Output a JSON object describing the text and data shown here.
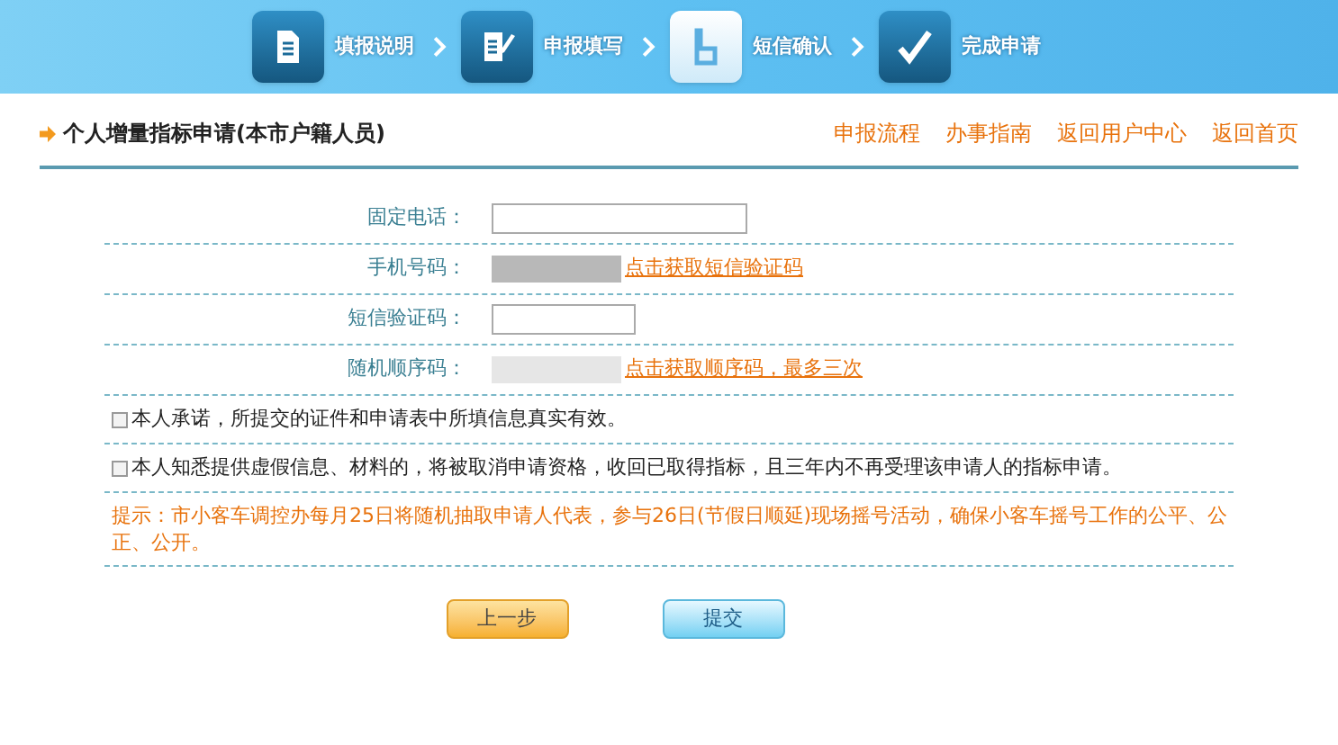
{
  "steps": [
    {
      "label": "填报说明",
      "selected": false
    },
    {
      "label": "申报填写",
      "selected": false
    },
    {
      "label": "短信确认",
      "selected": true
    },
    {
      "label": "完成申请",
      "selected": false
    }
  ],
  "page_title": "个人增量指标申请(本市户籍人员)",
  "nav_links": [
    "申报流程",
    "办事指南",
    "返回用户中心",
    "返回首页"
  ],
  "fields": [
    {
      "kind": "wide_input",
      "label": "固定电话："
    },
    {
      "kind": "mobile",
      "label": "手机号码：",
      "link": "点击获取短信验证码"
    },
    {
      "kind": "short_input",
      "label": "短信验证码："
    },
    {
      "kind": "sequence",
      "label": "随机顺序码：",
      "link": "点击获取顺序码，最多三次"
    }
  ],
  "pledges": [
    {
      "text": "本人承诺，所提交的证件和申请表中所填信息真实有效。",
      "checked": false
    },
    {
      "text": "本人知悉提供虚假信息、材料的，将被取消申请资格，收回已取得指标，且三年内不再受理该申请人的指标申请。",
      "checked": false
    }
  ],
  "notice": "提示：市小客车调控办每月25日将随机抽取申请人代表，参与26日(节假日顺延)现场摇号活动，确保小客车摇号工作的公平、公正、公开。",
  "buttons": [
    {
      "label": "上一步",
      "kind": "back"
    },
    {
      "label": "提交",
      "kind": "submit"
    }
  ]
}
